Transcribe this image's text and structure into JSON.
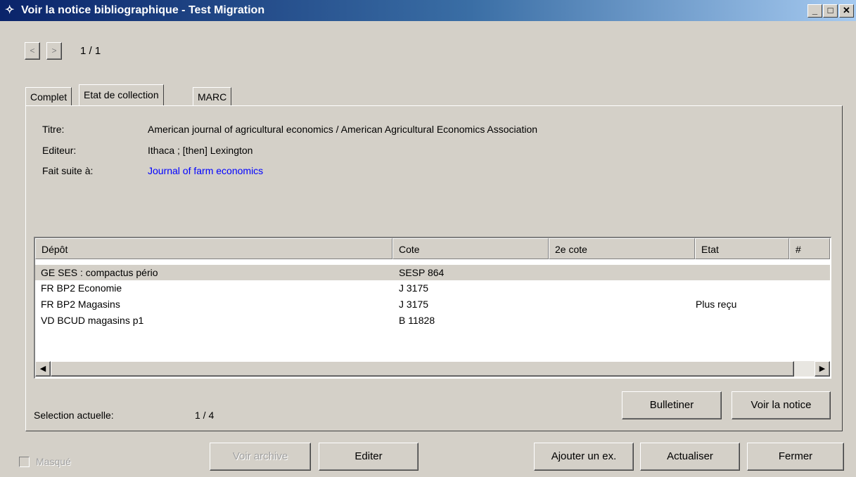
{
  "window": {
    "title": "Voir la notice bibliographique - Test Migration",
    "controls": {
      "minimize": "_",
      "maximize": "□",
      "close": "✕"
    }
  },
  "pager": {
    "prev": "<",
    "next": ">",
    "counter": "1 / 1"
  },
  "tabs": [
    {
      "label": "Complet",
      "active": false
    },
    {
      "label": "Etat de collection",
      "active": true
    },
    {
      "label": "MARC",
      "active": false
    }
  ],
  "record": {
    "title_label": "Titre:",
    "title_value": "American journal of agricultural economics / American Agricultural Economics Association",
    "publisher_label": "Editeur:",
    "publisher_value": "Ithaca ; [then] Lexington",
    "continues_label": "Fait suite à:",
    "continues_value": "Journal of farm economics"
  },
  "table": {
    "columns": [
      "Dépôt",
      "Cote",
      "2e cote",
      "Etat",
      "#"
    ],
    "rows": [
      {
        "depot": "GE SES : compactus pério",
        "cote": "SESP 864",
        "cote2": "",
        "etat": "",
        "num": "",
        "selected": true
      },
      {
        "depot": "FR BP2 Economie",
        "cote": "J 3175",
        "cote2": "",
        "etat": "",
        "num": "",
        "selected": false
      },
      {
        "depot": "FR BP2 Magasins",
        "cote": "J 3175",
        "cote2": "",
        "etat": "Plus reçu",
        "num": "",
        "selected": false
      },
      {
        "depot": "VD BCUD magasins p1",
        "cote": "B 11828",
        "cote2": "",
        "etat": "",
        "num": "",
        "selected": false
      }
    ]
  },
  "selection": {
    "label": "Selection actuelle:",
    "value": "1 / 4"
  },
  "panel_buttons": {
    "bulletiner": "Bulletiner",
    "voir_notice": "Voir la notice"
  },
  "footer": {
    "masque_label": "Masqué",
    "voir_archive": "Voir archive",
    "editer": "Editer",
    "ajouter": "Ajouter un ex.",
    "actualiser": "Actualiser",
    "fermer": "Fermer"
  },
  "colors": {
    "titlebar_start": "#0a246a",
    "titlebar_end": "#a6caf0",
    "link": "#0000ff",
    "face": "#d4d0c8"
  }
}
